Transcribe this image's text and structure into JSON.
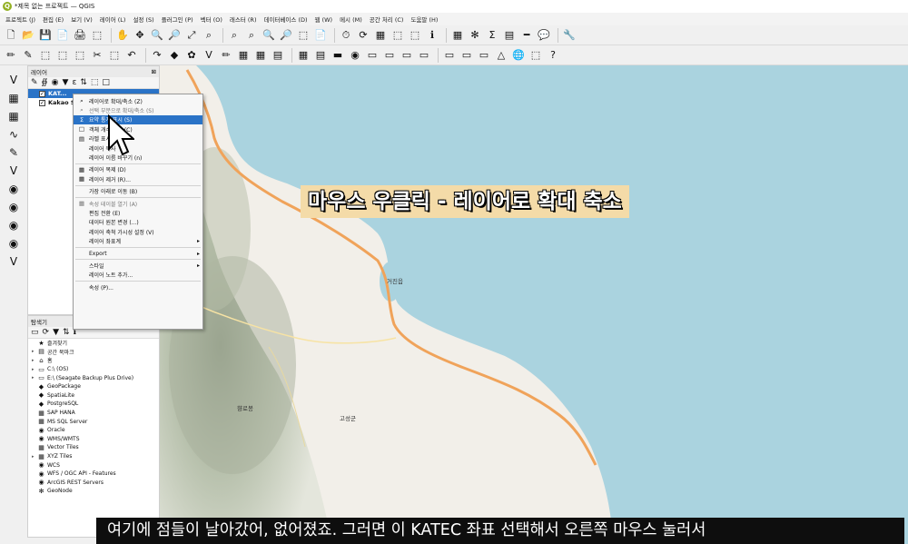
{
  "window": {
    "title": "*제목 없는 프로젝트 — QGIS",
    "app_icon_letter": "Q"
  },
  "menu": [
    "프로젝트 (J)",
    "편집 (E)",
    "보기 (V)",
    "레이어 (L)",
    "설정 (S)",
    "플러그인 (P)",
    "벡터 (O)",
    "래스터 (R)",
    "데이터베이스 (D)",
    "웹 (W)",
    "메시 (M)",
    "공간 처리 (C)",
    "도움말 (H)"
  ],
  "toolbar1_icons": [
    "🗋",
    "📂",
    "💾",
    "📄",
    "🖨",
    "⬚",
    "✋",
    "✥",
    "🔍",
    "🔎",
    "⤢",
    "⌕",
    "⌕",
    "⌕",
    "🔍",
    "🔎",
    "⬚",
    "📄",
    "⏱",
    "⟳",
    "▦",
    "⬚",
    "⬚",
    "ℹ",
    "▦",
    "✻",
    "Σ",
    "▤",
    "━",
    "💬",
    "🔧"
  ],
  "toolbar2_icons": [
    "✏",
    "✎",
    "⬚",
    "⬚",
    "⬚",
    "✂",
    "⬚",
    "↶",
    "↷",
    "◆",
    "✿",
    "V",
    "✏",
    "▦",
    "▦",
    "▤",
    "▦",
    "▤",
    "▬",
    "◉",
    "▭",
    "▭",
    "▭",
    "▭",
    "▭",
    "▭",
    "▭",
    "△",
    "🌐",
    "⬚",
    "?"
  ],
  "vtoolbar_icons": [
    "V",
    "▦",
    "▦",
    "∿",
    "✎",
    "V",
    "◉",
    "◉",
    "◉",
    "◉",
    "V"
  ],
  "layers_panel": {
    "title": "레이어",
    "close_label": "⊠",
    "tools": [
      "✎",
      "∯",
      "◉",
      "▼",
      "ε",
      "⇅",
      "⬚",
      "□"
    ],
    "layers": [
      {
        "label": "KAT...",
        "checked": true,
        "selected": true
      },
      {
        "label": "Kakao S...",
        "checked": true,
        "selected": false
      }
    ]
  },
  "context_menu": {
    "items": [
      {
        "label": "레이어로 확대/축소 (Z)",
        "icon": "⌕",
        "state": "normal"
      },
      {
        "label": "선택 부분으로 확대/축소 (S)",
        "icon": "⌕",
        "state": "dim"
      },
      {
        "label": "요약 통계 표시 (S)",
        "icon": "Σ",
        "state": "highlight"
      },
      {
        "label": "객체 개수 표시 (C)",
        "icon": "□",
        "state": "normal"
      },
      {
        "label": "라벨 표시",
        "icon": "▤",
        "state": "normal"
      },
      {
        "label": "레이어 복사",
        "icon": "",
        "state": "normal"
      },
      {
        "label": "레이어 이름 바꾸기 (n)",
        "icon": "",
        "state": "normal",
        "sep_after": true
      },
      {
        "label": "레이어 복제 (D)",
        "icon": "▦",
        "state": "normal"
      },
      {
        "label": "레이어 제거 (R)...",
        "icon": "▦",
        "state": "normal",
        "sep_after": true
      },
      {
        "label": "가장 아래로 이동 (B)",
        "icon": "",
        "state": "normal",
        "sep_after": true
      },
      {
        "label": "속성 테이블 열기 (A)",
        "icon": "▦",
        "state": "dim"
      },
      {
        "label": "편집 전환 (E)",
        "icon": "",
        "state": "normal"
      },
      {
        "label": "데이터 원본 변경 (...)",
        "icon": "",
        "state": "normal"
      },
      {
        "label": "레이어 축척 가시성 설정 (V)",
        "icon": "",
        "state": "normal"
      },
      {
        "label": "레이어 좌표계",
        "icon": "",
        "state": "normal",
        "submenu": true,
        "sep_after": true
      },
      {
        "label": "Export",
        "icon": "",
        "state": "normal",
        "submenu": true,
        "sep_after": true
      },
      {
        "label": "스타일",
        "icon": "",
        "state": "normal",
        "submenu": true
      },
      {
        "label": "레이어 노트 추가...",
        "icon": "",
        "state": "normal",
        "sep_after": true
      },
      {
        "label": "속성 (P)...",
        "icon": "",
        "state": "normal"
      }
    ]
  },
  "browser_panel": {
    "title": "탐색기",
    "close_label": "⊠",
    "tools": [
      "▭",
      "⟳",
      "▼",
      "⇅",
      "ℹ"
    ],
    "items": [
      {
        "label": "즐겨찾기",
        "icon": "★",
        "arrow": ""
      },
      {
        "label": "공간 북마크",
        "icon": "▤",
        "arrow": "▸"
      },
      {
        "label": "홈",
        "icon": "⌂",
        "arrow": "▸"
      },
      {
        "label": "C:\\ (OS)",
        "icon": "▭",
        "arrow": "▸"
      },
      {
        "label": "E:\\ (Seagate Backup Plus Drive)",
        "icon": "▭",
        "arrow": "▸"
      },
      {
        "label": "GeoPackage",
        "icon": "◆",
        "arrow": ""
      },
      {
        "label": "SpatiaLite",
        "icon": "◆",
        "arrow": ""
      },
      {
        "label": "PostgreSQL",
        "icon": "◆",
        "arrow": ""
      },
      {
        "label": "SAP HANA",
        "icon": "▦",
        "arrow": ""
      },
      {
        "label": "MS SQL Server",
        "icon": "▦",
        "arrow": ""
      },
      {
        "label": "Oracle",
        "icon": "◉",
        "arrow": ""
      },
      {
        "label": "WMS/WMTS",
        "icon": "◉",
        "arrow": ""
      },
      {
        "label": "Vector Tiles",
        "icon": "▦",
        "arrow": ""
      },
      {
        "label": "XYZ Tiles",
        "icon": "▦",
        "arrow": "▸"
      },
      {
        "label": "WCS",
        "icon": "◉",
        "arrow": ""
      },
      {
        "label": "WFS / OGC API - Features",
        "icon": "◉",
        "arrow": ""
      },
      {
        "label": "ArcGIS REST Servers",
        "icon": "◉",
        "arrow": ""
      },
      {
        "label": "GeoNode",
        "icon": "✻",
        "arrow": ""
      }
    ]
  },
  "map": {
    "labels": [
      "고성군",
      "거진읍",
      "향로봉"
    ]
  },
  "annotation": "마우스 우클릭 - 레이어로 확대 축소",
  "subtitle": "여기에 점들이 날아갔어, 없어졌죠. 그러면 이 KATEC 좌표 선택해서 오른쪽 마우스 눌러서",
  "colors": {
    "selection": "#2a73c7",
    "sea": "#aad3df",
    "land": "#f2efe9",
    "road": "#f0a35a",
    "annotation_bg": "#f4dba8"
  }
}
